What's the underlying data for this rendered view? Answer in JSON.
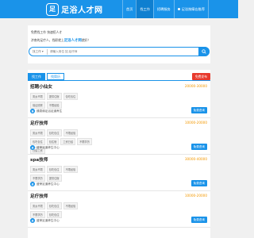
{
  "header": {
    "logo_mark": "足",
    "logo_text": "足浴人才网",
    "nav": [
      {
        "label": "首页",
        "active": false
      },
      {
        "label": "找工作",
        "active": true
      },
      {
        "label": "招聘服务",
        "active": false
      },
      {
        "label": "足浴按摩店推荐",
        "active": false
      }
    ]
  },
  "intro": {
    "line1": "免费找工作 快速招人才",
    "line2_prefix": "济南的足疗人，找职就上",
    "line2_brand": "足浴人才网",
    "line2_suffix": "就好！"
  },
  "search": {
    "category": "找工作",
    "placeholder": "请输入岗位 如 足疗师",
    "button_icon": "search-icon"
  },
  "tabs": [
    {
      "label": "找工作",
      "active": true
    },
    {
      "label": "找简历",
      "active": false
    }
  ],
  "post_button": "免费发布",
  "jobs": [
    {
      "title": "招聘小仙女",
      "salary": "20000-30000",
      "tags": [
        "男女不限",
        "提供住宿",
        "包吃包住",
        "保证底薪",
        "不限经验"
      ],
      "company": "臻泉缘足浴足道养生",
      "company_logo": "臻",
      "apply": "免费咨询"
    },
    {
      "title": "足疗技师",
      "salary": "10000-20000",
      "tags": [
        "男女不限",
        "包吃包住",
        "不限经验",
        "包吃包住",
        "包住宿",
        "工资日结",
        "不限学历",
        "日结工资"
      ],
      "company": "盛荣足道养生中心",
      "company_logo": "盛",
      "apply": "免费咨询"
    },
    {
      "title": "spa技师",
      "salary": "30000-40000",
      "tags": [
        "男女不限",
        "包吃包住",
        "不限经验",
        "不限学历",
        "提供住宿"
      ],
      "company": "盛荣足道养生中心",
      "company_logo": "盛",
      "apply": "免费咨询"
    },
    {
      "title": "足疗技师",
      "salary": "10000-20000",
      "tags": [
        "男女不限",
        "包吃包住",
        "不限经验",
        "不限学历",
        "包吃包住"
      ],
      "company": "盛荣足道养生中心",
      "company_logo": "盛",
      "apply": "免费咨询"
    }
  ]
}
